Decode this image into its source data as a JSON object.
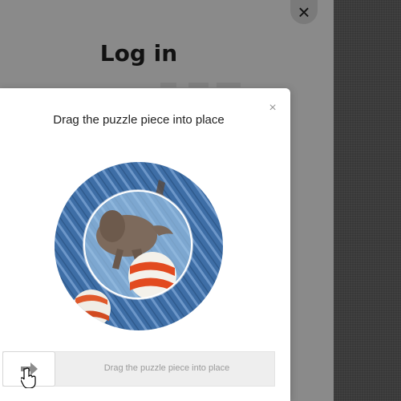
{
  "login": {
    "title": "Log in",
    "close_label": "×"
  },
  "captcha": {
    "title": "Drag the puzzle piece into place",
    "close_label": "×",
    "slider_label": "Drag the puzzle piece into place",
    "knob_icon": "arrow-right-icon"
  }
}
